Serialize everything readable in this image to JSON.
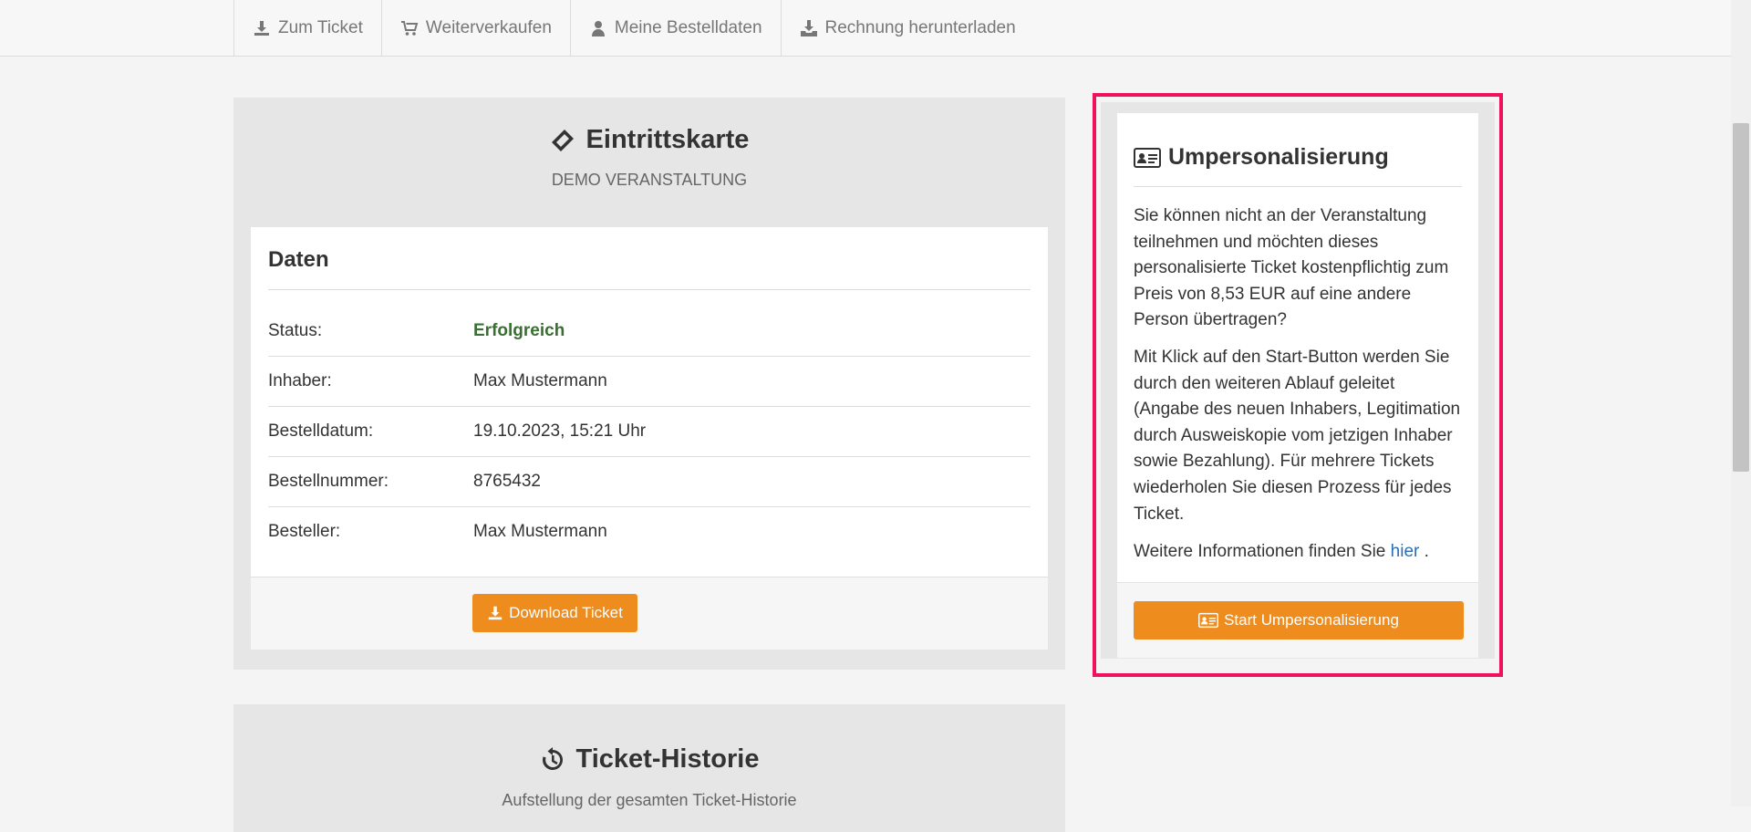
{
  "nav": {
    "items": [
      {
        "label": "Zum Ticket",
        "icon": "download-icon"
      },
      {
        "label": "Weiterverkaufen",
        "icon": "cart-icon"
      },
      {
        "label": "Meine Bestelldaten",
        "icon": "user-icon"
      },
      {
        "label": "Rechnung herunterladen",
        "icon": "download-tray-icon"
      }
    ]
  },
  "ticket": {
    "title": "Eintrittskarte",
    "subtitle": "DEMO VERANSTALTUNG",
    "data_heading": "Daten",
    "rows": [
      {
        "key": "Status:",
        "value": "Erfolgreich"
      },
      {
        "key": "Inhaber:",
        "value": "Max Mustermann"
      },
      {
        "key": "Bestelldatum:",
        "value": "19.10.2023, 15:21 Uhr"
      },
      {
        "key": "Bestellnummer:",
        "value": "8765432"
      },
      {
        "key": "Besteller:",
        "value": "Max Mustermann"
      }
    ],
    "download_label": "Download Ticket"
  },
  "history": {
    "title": "Ticket-Historie",
    "subtitle": "Aufstellung der gesamten Ticket-Historie"
  },
  "transfer": {
    "title": "Umpersonalisierung",
    "para1": "Sie können nicht an der Veranstaltung teilnehmen und möchten dieses personalisierte Ticket kostenpflichtig zum Preis von 8,53 EUR auf eine andere Person übertragen?",
    "para2": "Mit Klick auf den Start-Button werden Sie durch den weiteren Ablauf geleitet (Angabe des neuen Inhabers, Legitimation durch Ausweiskopie vom jetzigen Inhaber sowie Bezahlung). Für mehrere Tickets wiederholen Sie diesen Prozess für jedes Ticket.",
    "para3_prefix": "Weitere Informationen finden Sie",
    "para3_link": "hier",
    "para3_suffix": ".",
    "start_label": "Start Umpersonalisierung"
  },
  "colors": {
    "accent": "#ef8c1e",
    "success": "#3a6e33",
    "link": "#2a6db5",
    "highlight": "#f0115a"
  }
}
